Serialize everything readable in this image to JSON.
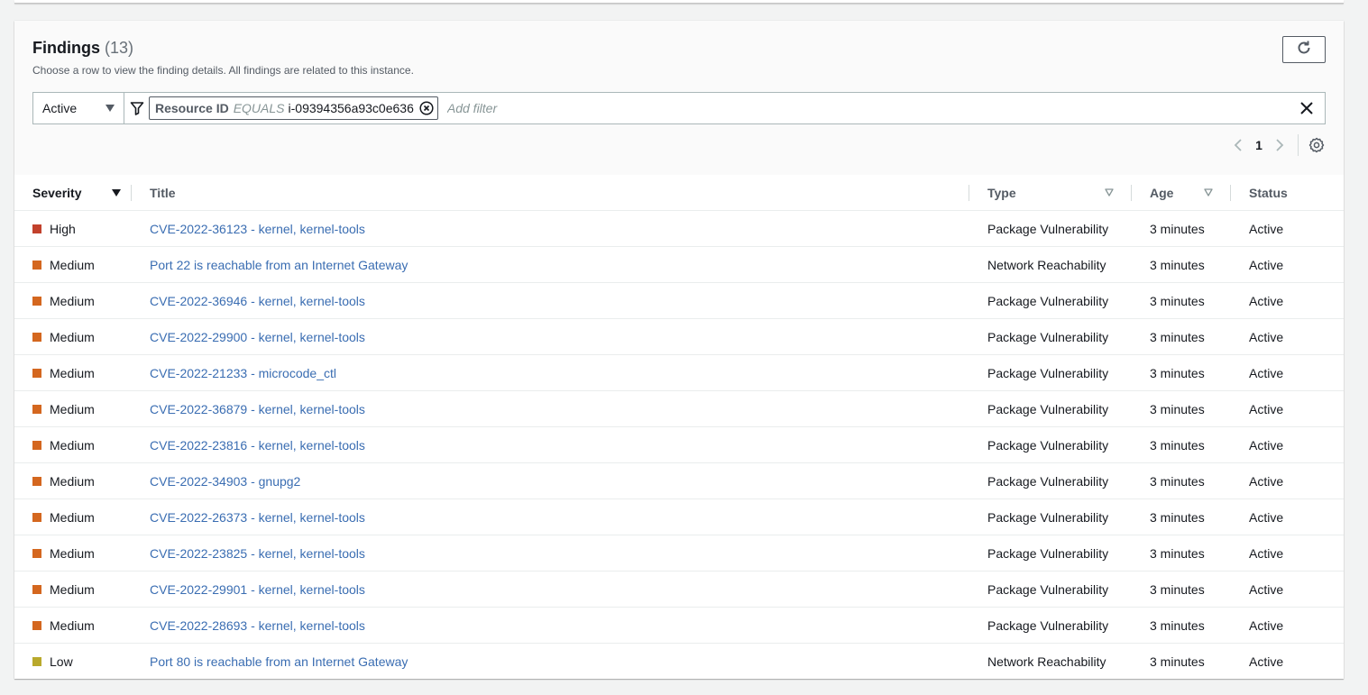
{
  "panel": {
    "title": "Findings",
    "count": "(13)",
    "description": "Choose a row to view the finding details. All findings are related to this instance."
  },
  "filter": {
    "status_value": "Active",
    "token_key": "Resource ID",
    "token_operator": "EQUALS",
    "token_value": "i-09394356a93c0e636",
    "placeholder": "Add filter"
  },
  "pagination": {
    "current_page": "1"
  },
  "icons": {
    "refresh": "refresh-icon",
    "funnel": "funnel-icon",
    "remove_token": "remove-circle-icon",
    "clear": "close-icon",
    "prev": "chevron-left-icon",
    "next": "chevron-right-icon",
    "settings": "gear-icon"
  },
  "colors": {
    "high": "#c2412c",
    "medium": "#d4671f",
    "low": "#b9a92c",
    "link": "#3a6db2"
  },
  "table": {
    "columns": [
      "Severity",
      "Title",
      "Type",
      "Age",
      "Status"
    ],
    "rows": [
      {
        "severity": "High",
        "title": "CVE-2022-36123 - kernel, kernel-tools",
        "type": "Package Vulnerability",
        "age": "3 minutes",
        "status": "Active"
      },
      {
        "severity": "Medium",
        "title": "Port 22 is reachable from an Internet Gateway",
        "type": "Network Reachability",
        "age": "3 minutes",
        "status": "Active"
      },
      {
        "severity": "Medium",
        "title": "CVE-2022-36946 - kernel, kernel-tools",
        "type": "Package Vulnerability",
        "age": "3 minutes",
        "status": "Active"
      },
      {
        "severity": "Medium",
        "title": "CVE-2022-29900 - kernel, kernel-tools",
        "type": "Package Vulnerability",
        "age": "3 minutes",
        "status": "Active"
      },
      {
        "severity": "Medium",
        "title": "CVE-2022-21233 - microcode_ctl",
        "type": "Package Vulnerability",
        "age": "3 minutes",
        "status": "Active"
      },
      {
        "severity": "Medium",
        "title": "CVE-2022-36879 - kernel, kernel-tools",
        "type": "Package Vulnerability",
        "age": "3 minutes",
        "status": "Active"
      },
      {
        "severity": "Medium",
        "title": "CVE-2022-23816 - kernel, kernel-tools",
        "type": "Package Vulnerability",
        "age": "3 minutes",
        "status": "Active"
      },
      {
        "severity": "Medium",
        "title": "CVE-2022-34903 - gnupg2",
        "type": "Package Vulnerability",
        "age": "3 minutes",
        "status": "Active"
      },
      {
        "severity": "Medium",
        "title": "CVE-2022-26373 - kernel, kernel-tools",
        "type": "Package Vulnerability",
        "age": "3 minutes",
        "status": "Active"
      },
      {
        "severity": "Medium",
        "title": "CVE-2022-23825 - kernel, kernel-tools",
        "type": "Package Vulnerability",
        "age": "3 minutes",
        "status": "Active"
      },
      {
        "severity": "Medium",
        "title": "CVE-2022-29901 - kernel, kernel-tools",
        "type": "Package Vulnerability",
        "age": "3 minutes",
        "status": "Active"
      },
      {
        "severity": "Medium",
        "title": "CVE-2022-28693 - kernel, kernel-tools",
        "type": "Package Vulnerability",
        "age": "3 minutes",
        "status": "Active"
      },
      {
        "severity": "Low",
        "title": "Port 80 is reachable from an Internet Gateway",
        "type": "Network Reachability",
        "age": "3 minutes",
        "status": "Active"
      }
    ]
  }
}
